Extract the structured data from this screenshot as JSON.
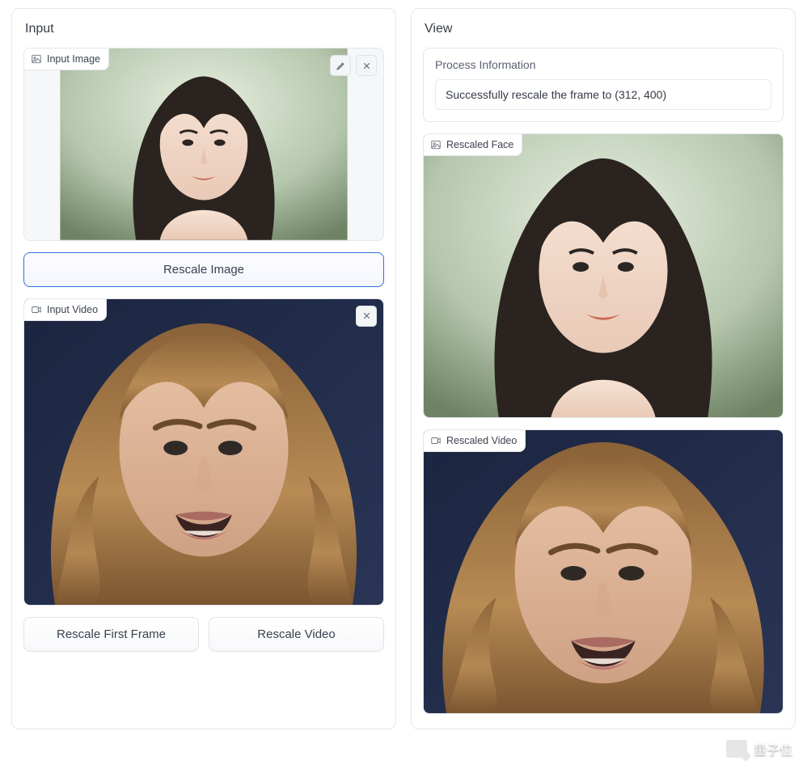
{
  "left": {
    "title": "Input",
    "input_image_tag": "Input Image",
    "rescale_image_label": "Rescale Image",
    "input_video_tag": "Input Video",
    "rescale_first_frame_label": "Rescale First Frame",
    "rescale_video_label": "Rescale Video"
  },
  "right": {
    "title": "View",
    "process_info_title": "Process Information",
    "process_info_body": "Successfully rescale the frame to (312, 400)",
    "rescaled_face_tag": "Rescaled Face",
    "rescaled_video_tag": "Rescaled Video"
  },
  "watermark": "量子位"
}
